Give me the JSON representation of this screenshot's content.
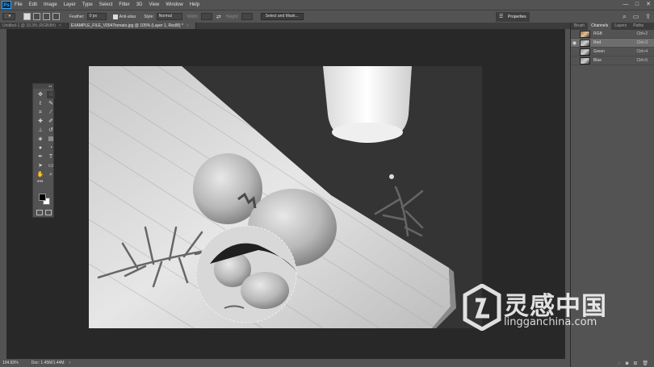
{
  "app": {
    "logo": "Ps",
    "menu": [
      "File",
      "Edit",
      "Image",
      "Layer",
      "Type",
      "Select",
      "Filter",
      "3D",
      "View",
      "Window",
      "Help"
    ],
    "window_controls": [
      "—",
      "□",
      "✕"
    ]
  },
  "options_bar": {
    "feather_label": "Feather:",
    "feather_value": "0 px",
    "anti_alias_label": "Anti-alias",
    "style_label": "Style:",
    "style_value": "Normal",
    "width_label": "Width:",
    "height_label": "Height:",
    "select_mask_label": "Select and Mask...",
    "properties_label": "Properties"
  },
  "tabs": [
    {
      "label": "Untitled-1 @ 33.3% (RGB/8#)",
      "active": false
    },
    {
      "label": "EXAMPLE_FILE_V0047tomato.jpg @ 105% (Layer 1, Red/8) *",
      "active": true
    }
  ],
  "status": {
    "zoom": "104.83%",
    "doc": "Doc: 1.45M/1.44M"
  },
  "toolbar": {
    "grip": "◂◂",
    "more": "•••"
  },
  "panel": {
    "tabs": [
      {
        "label": "Brush",
        "active": false
      },
      {
        "label": "Channels",
        "active": true
      },
      {
        "label": "Layers",
        "active": false
      },
      {
        "label": "Paths",
        "active": false
      }
    ],
    "channels": [
      {
        "name": "RGB",
        "shortcut": "Ctrl+2",
        "visible": false,
        "selected": false
      },
      {
        "name": "Red",
        "shortcut": "Ctrl+3",
        "visible": true,
        "selected": true
      },
      {
        "name": "Green",
        "shortcut": "Ctrl+4",
        "visible": false,
        "selected": false
      },
      {
        "name": "Blue",
        "shortcut": "Ctrl+5",
        "visible": false,
        "selected": false
      }
    ]
  },
  "watermark": {
    "title": "灵感中国",
    "url": "lingganchina.com"
  },
  "colors": {
    "ui_dark": "#535353",
    "canvas_bg": "#282828",
    "accent": "#31a8ff"
  }
}
